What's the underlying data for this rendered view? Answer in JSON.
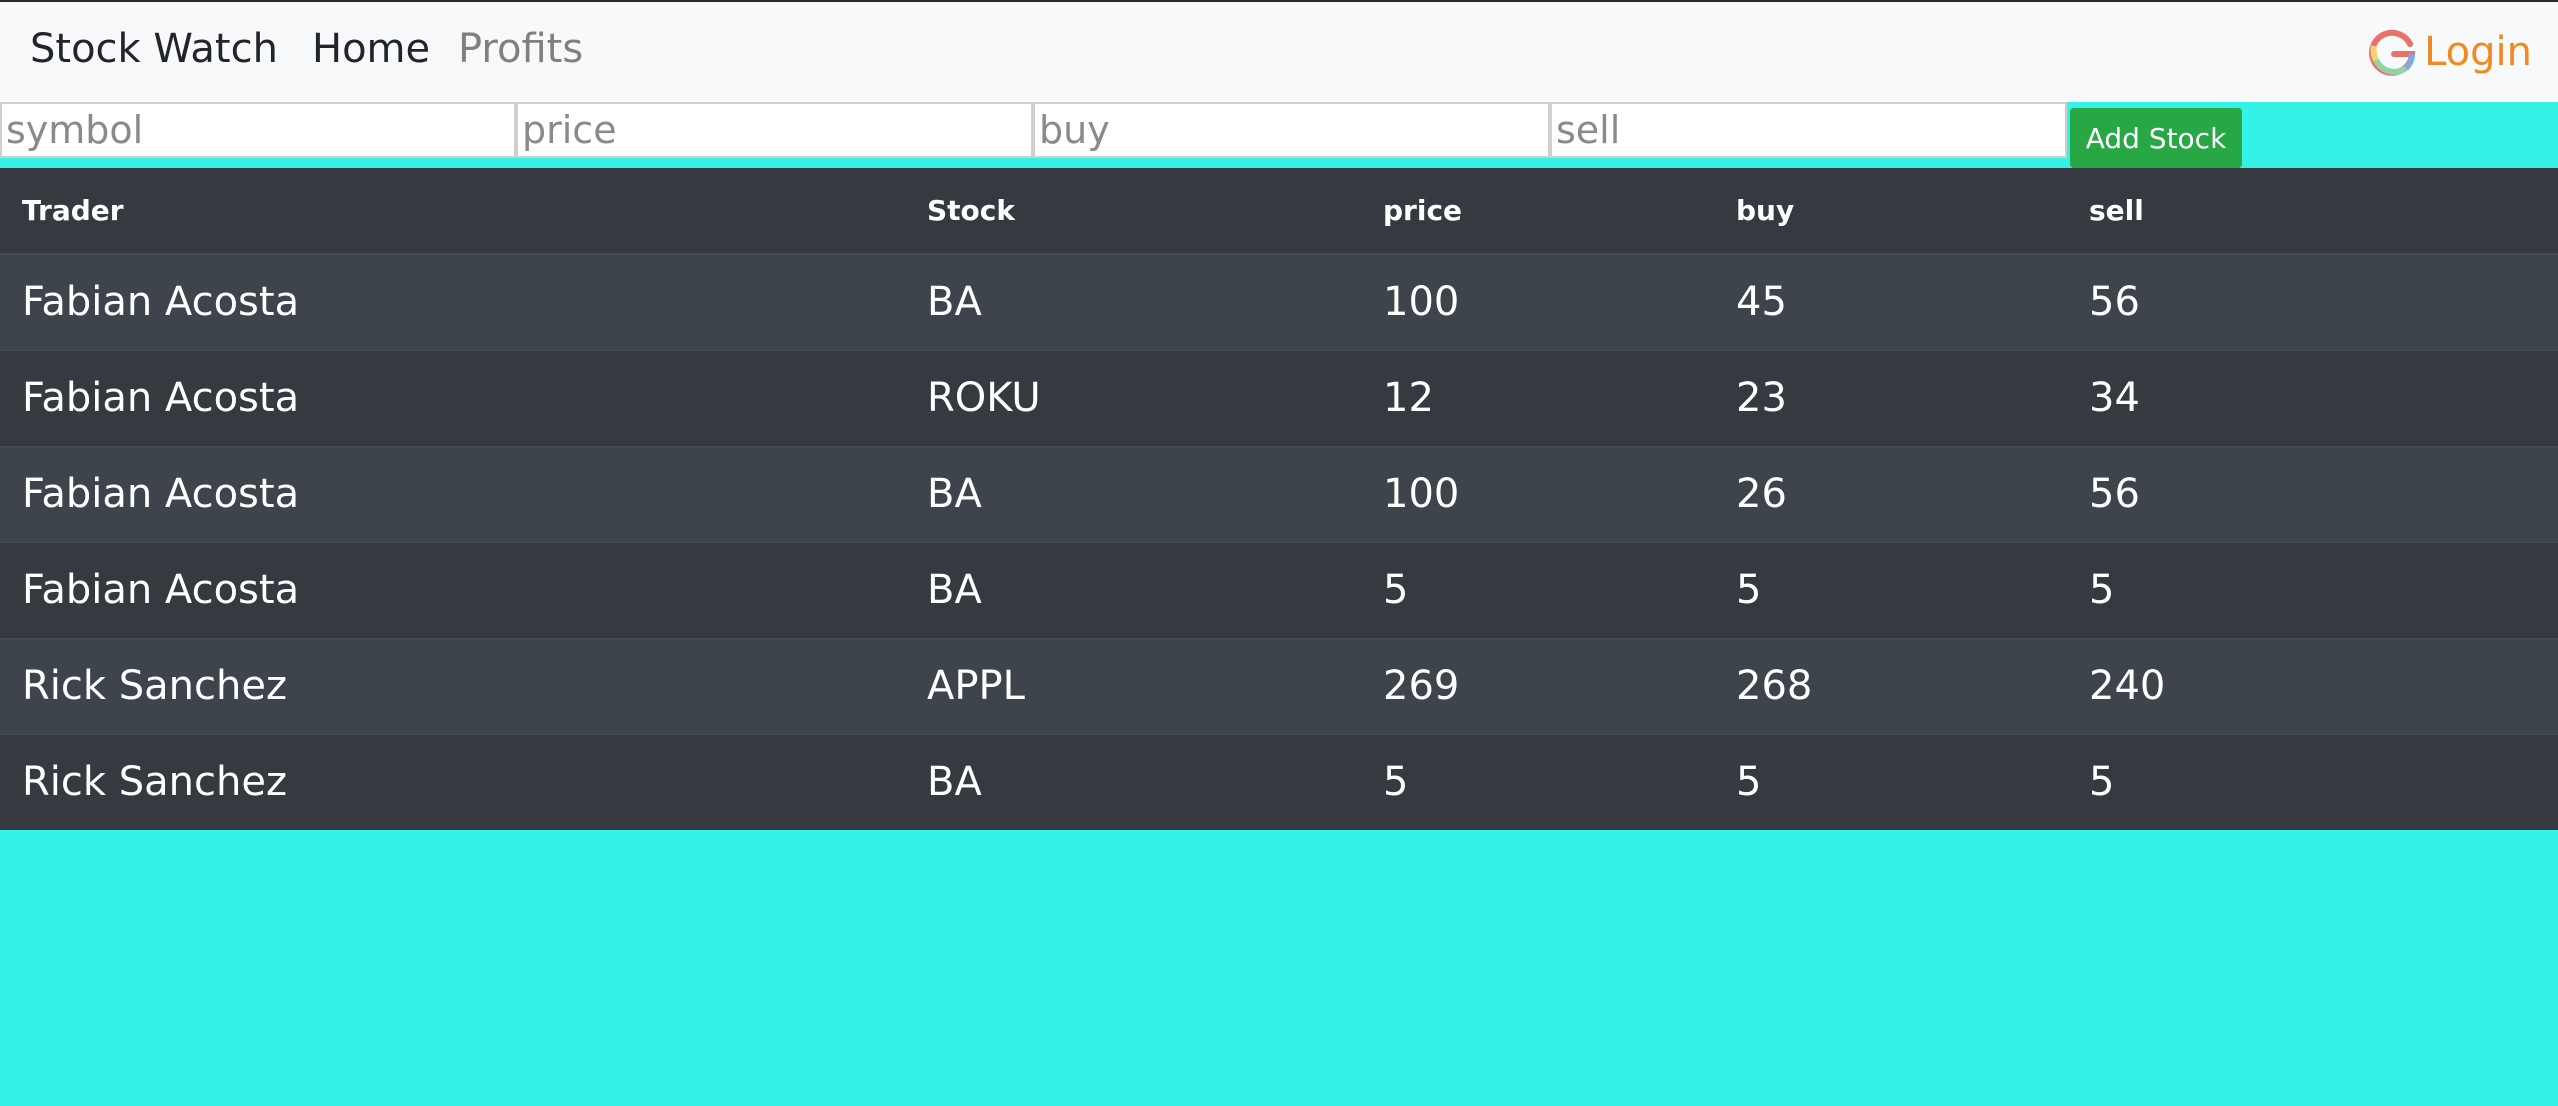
{
  "nav": {
    "brand": "Stock Watch",
    "home": "Home",
    "profits": "Profits",
    "login": "Login"
  },
  "form": {
    "symbol_placeholder": "symbol",
    "price_placeholder": "price",
    "buy_placeholder": "buy",
    "sell_placeholder": "sell",
    "add_label": "Add Stock"
  },
  "table": {
    "headers": [
      "Trader",
      "Stock",
      "price",
      "buy",
      "sell"
    ],
    "rows": [
      [
        "Fabian Acosta",
        "BA",
        "100",
        "45",
        "56"
      ],
      [
        "Fabian Acosta",
        "ROKU",
        "12",
        "23",
        "34"
      ],
      [
        "Fabian Acosta",
        "BA",
        "100",
        "26",
        "56"
      ],
      [
        "Fabian Acosta",
        "BA",
        "5",
        "5",
        "5"
      ],
      [
        "Rick Sanchez",
        "APPL",
        "269",
        "268",
        "240"
      ],
      [
        "Rick Sanchez",
        "BA",
        "5",
        "5",
        "5"
      ]
    ]
  },
  "colors": {
    "page_background": "#34f2e5",
    "table_dark": "#343a40",
    "table_stripe": "#3e444b",
    "add_button": "#28a745",
    "login_text": "#f08a22"
  },
  "icons": {
    "login_icon": "google-g-icon"
  }
}
